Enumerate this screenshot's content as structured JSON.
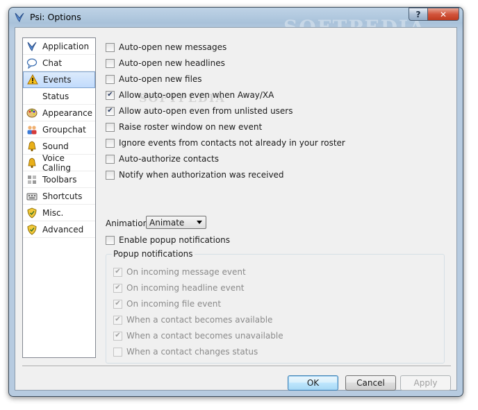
{
  "window": {
    "title": "Psi: Options",
    "help_label": "?",
    "close_label": "✕",
    "watermark": "SOFTPEDIA",
    "watermark_small": "SOFTPEDIA"
  },
  "sidebar": {
    "items": [
      {
        "label": "Application",
        "icon": "psi-feather-icon",
        "selected": false
      },
      {
        "label": "Chat",
        "icon": "chat-bubble-icon",
        "selected": false
      },
      {
        "label": "Events",
        "icon": "warning-icon",
        "selected": true
      },
      {
        "label": "Status",
        "icon": "status-icon",
        "selected": false
      },
      {
        "label": "Appearance",
        "icon": "palette-icon",
        "selected": false
      },
      {
        "label": "Groupchat",
        "icon": "groupchat-icon",
        "selected": false
      },
      {
        "label": "Sound",
        "icon": "bell-icon",
        "selected": false
      },
      {
        "label": "Voice Calling",
        "icon": "bell-icon",
        "selected": false
      },
      {
        "label": "Toolbars",
        "icon": "toolbars-icon",
        "selected": false
      },
      {
        "label": "Shortcuts",
        "icon": "keyboard-icon",
        "selected": false
      },
      {
        "label": "Misc.",
        "icon": "shield-icon",
        "selected": false
      },
      {
        "label": "Advanced",
        "icon": "shield-icon",
        "selected": false
      }
    ]
  },
  "events": {
    "options": [
      {
        "label": "Auto-open new messages",
        "checked": false
      },
      {
        "label": "Auto-open new headlines",
        "checked": false
      },
      {
        "label": "Auto-open new files",
        "checked": false
      },
      {
        "label": "Allow auto-open even when Away/XA",
        "checked": true
      },
      {
        "label": "Allow auto-open even from unlisted users",
        "checked": true
      },
      {
        "label": "Raise roster window on new event",
        "checked": false
      },
      {
        "label": "Ignore events from contacts not already in your roster",
        "checked": false
      },
      {
        "label": "Auto-authorize contacts",
        "checked": false
      },
      {
        "label": "Notify when authorization was received",
        "checked": false
      }
    ],
    "animation_label": "Animation:",
    "animation_value": "Animate",
    "popup_enable": {
      "label": "Enable popup notifications",
      "checked": false
    },
    "popup_group_title": "Popup notifications",
    "popup_options": [
      {
        "label": "On incoming message event",
        "checked": true
      },
      {
        "label": "On incoming headline event",
        "checked": true
      },
      {
        "label": "On incoming file event",
        "checked": true
      },
      {
        "label": "When a contact becomes available",
        "checked": true
      },
      {
        "label": "When a contact becomes unavailable",
        "checked": true
      },
      {
        "label": "When a contact changes status",
        "checked": false
      }
    ]
  },
  "buttons": {
    "ok": "OK",
    "cancel": "Cancel",
    "apply": "Apply"
  },
  "colors": {
    "selection_top": "#dceafb",
    "selection_bottom": "#c1dbfc",
    "close_red": "#c6402a",
    "check_mark": "#2b3d63"
  }
}
